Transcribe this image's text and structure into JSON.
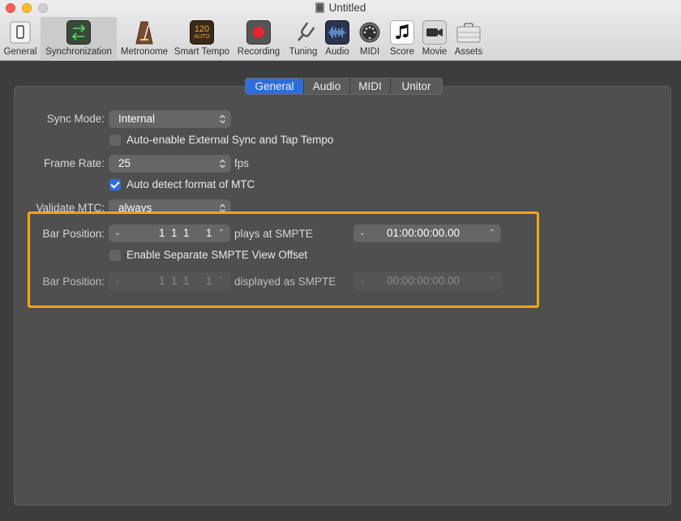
{
  "window": {
    "title": "Untitled"
  },
  "toolbar": {
    "items": [
      {
        "label": "General",
        "icon": "general-icon"
      },
      {
        "label": "Synchronization",
        "icon": "sync-icon",
        "active": true
      },
      {
        "label": "Metronome",
        "icon": "metronome-icon"
      },
      {
        "label": "Smart Tempo",
        "icon": "smart-tempo-icon",
        "icon_text_top": "120",
        "icon_text_bottom": "AUTO"
      },
      {
        "label": "Recording",
        "icon": "record-icon"
      },
      {
        "label": "Tuning",
        "icon": "tuning-fork-icon"
      },
      {
        "label": "Audio",
        "icon": "audio-waveform-icon"
      },
      {
        "label": "MIDI",
        "icon": "midi-connector-icon"
      },
      {
        "label": "Score",
        "icon": "score-notes-icon"
      },
      {
        "label": "Movie",
        "icon": "movie-camera-icon"
      },
      {
        "label": "Assets",
        "icon": "briefcase-icon"
      }
    ]
  },
  "tabs": [
    {
      "label": "General",
      "active": true
    },
    {
      "label": "Audio"
    },
    {
      "label": "MIDI"
    },
    {
      "label": "Unitor"
    }
  ],
  "form": {
    "sync_mode": {
      "label": "Sync Mode:",
      "value": "Internal"
    },
    "auto_enable": {
      "label": "Auto-enable External Sync and Tap Tempo",
      "checked": false
    },
    "frame_rate": {
      "label": "Frame Rate:",
      "value": "25",
      "unit": "fps"
    },
    "auto_detect": {
      "label": "Auto detect format of MTC",
      "checked": true
    },
    "validate_mtc": {
      "label": "Validate MTC:",
      "value": "always"
    },
    "bar_position_1": {
      "label": "Bar Position:",
      "bars": "1  1  1",
      "ticks": "1",
      "link": "plays at SMPTE",
      "smpte": "01:00:00:00.00"
    },
    "separate_offset": {
      "label": "Enable Separate SMPTE View Offset",
      "checked": false
    },
    "bar_position_2": {
      "label": "Bar Position:",
      "bars": "1  1  1",
      "ticks": "1",
      "link": "displayed as SMPTE",
      "smpte": "00:00:00:00.00"
    }
  },
  "colors": {
    "accent": "#2f6dd9",
    "highlight": "#f4a614",
    "panel": "#4f4f4f"
  }
}
